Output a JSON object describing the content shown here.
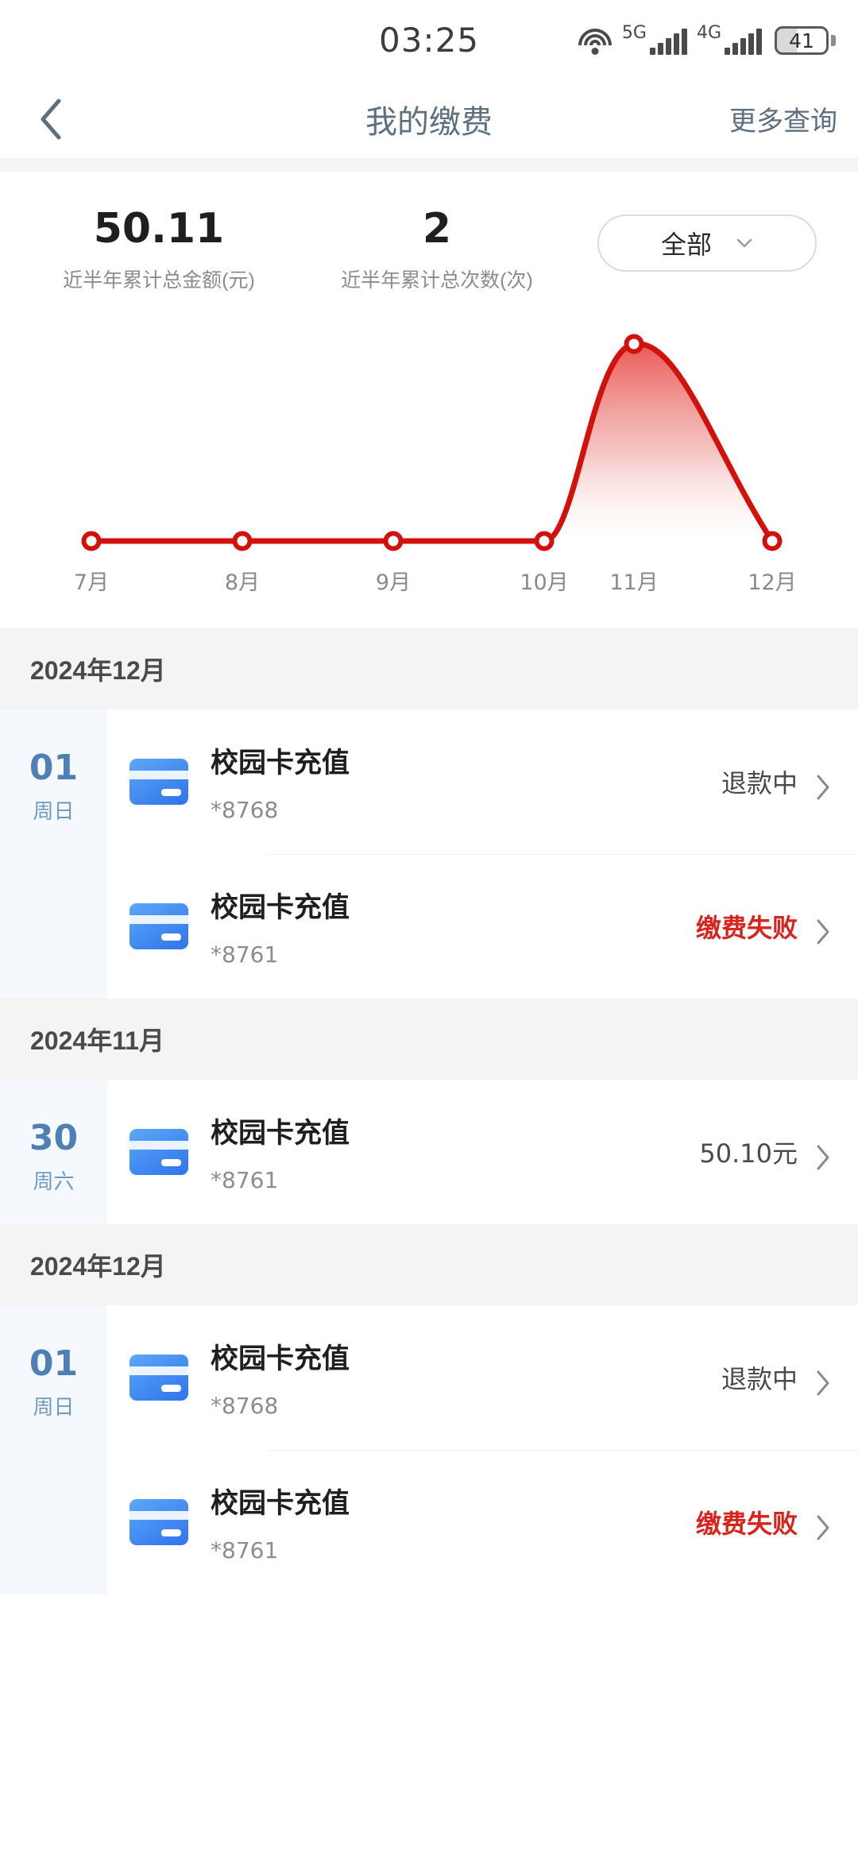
{
  "statusbar": {
    "time": "03:25",
    "wifi_icon": "wifi-icon",
    "net1_label": "5G",
    "net2_label": "4G",
    "battery_level": "41"
  },
  "navbar": {
    "back_icon": "chevron-left-icon",
    "title": "我的缴费",
    "more_label": "更多查询"
  },
  "summary": {
    "stats": [
      {
        "value": "50.11",
        "label": "近半年累计总金额(元)"
      },
      {
        "value": "2",
        "label": "近半年累计总次数(次)"
      }
    ],
    "filter": {
      "label": "全部",
      "chevron_icon": "chevron-down-icon"
    }
  },
  "chart_data": {
    "type": "area",
    "title": "",
    "xlabel": "",
    "ylabel": "",
    "categories": [
      "7月",
      "8月",
      "9月",
      "10月",
      "11月",
      "12月"
    ],
    "values": [
      0,
      0,
      0,
      0,
      50.1,
      0
    ],
    "ylim": [
      0,
      50.1
    ],
    "grid": false,
    "legend": "none",
    "line_color": "#d2100c",
    "fill_gradient": [
      "#e8504c",
      "#ffffff"
    ],
    "marker": "open-circle"
  },
  "sections": [
    {
      "month_label": "2024年12月",
      "days": [
        {
          "day": "01",
          "weekday": "周日",
          "rows": [
            {
              "icon": "bank-card-icon",
              "title": "校园卡充值",
              "subtitle": "*8768",
              "status": "退款中",
              "status_type": "normal",
              "chevron_icon": "chevron-right-icon"
            },
            {
              "icon": "bank-card-icon",
              "title": "校园卡充值",
              "subtitle": "*8761",
              "status": "缴费失败",
              "status_type": "fail",
              "chevron_icon": "chevron-right-icon"
            }
          ]
        }
      ]
    },
    {
      "month_label": "2024年11月",
      "days": [
        {
          "day": "30",
          "weekday": "周六",
          "rows": [
            {
              "icon": "bank-card-icon",
              "title": "校园卡充值",
              "subtitle": "*8761",
              "status": "50.10元",
              "status_type": "amount",
              "chevron_icon": "chevron-right-icon"
            }
          ]
        }
      ]
    },
    {
      "month_label": "2024年12月",
      "days": [
        {
          "day": "01",
          "weekday": "周日",
          "rows": [
            {
              "icon": "bank-card-icon",
              "title": "校园卡充值",
              "subtitle": "*8768",
              "status": "退款中",
              "status_type": "normal",
              "chevron_icon": "chevron-right-icon"
            },
            {
              "icon": "bank-card-icon",
              "title": "校园卡充值",
              "subtitle": "*8761",
              "status": "缴费失败",
              "status_type": "fail",
              "chevron_icon": "chevron-right-icon"
            }
          ]
        }
      ]
    }
  ]
}
